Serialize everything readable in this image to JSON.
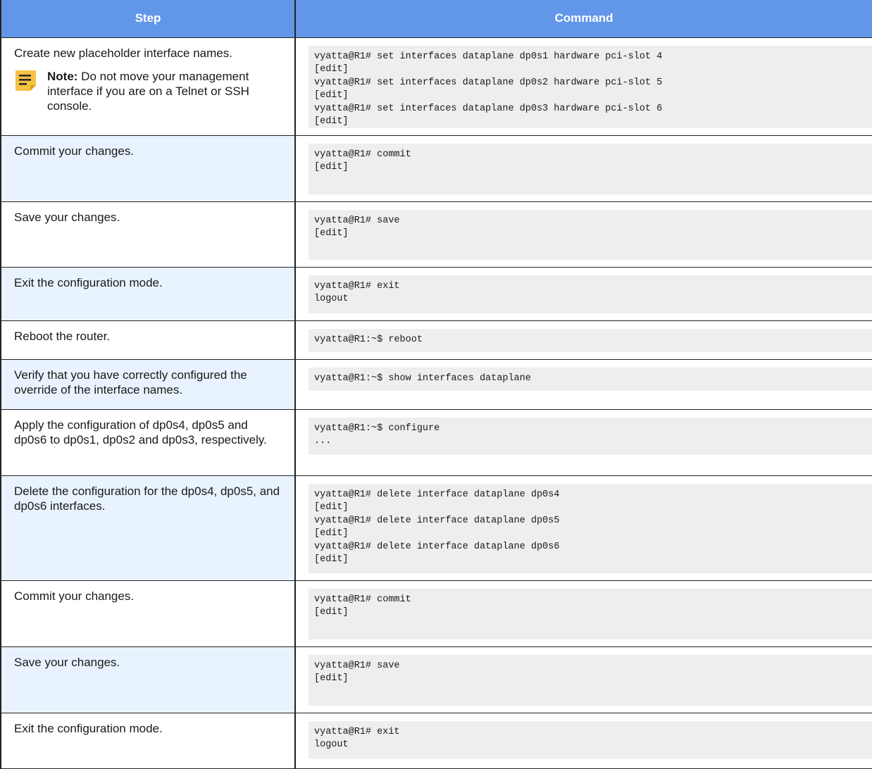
{
  "table": {
    "headers": {
      "step": "Step",
      "command": "Command"
    },
    "rows": [
      {
        "step": "Create new placeholder interface names.",
        "note_label": "Note:",
        "note_text": " Do not move your manage­ment interface if you are on a Telnet or SSH console.",
        "command_lines": [
          "vyatta@R1# set interfaces dataplane dp0s1 hardware pci-slot 4",
          "[edit]",
          "vyatta@R1# set interfaces dataplane dp0s2 hardware pci-slot 5",
          "[edit]",
          "vyatta@R1# set interfaces dataplane dp0s3 hardware pci-slot 6",
          "[edit]"
        ]
      },
      {
        "step": "Commit your changes.",
        "command_lines": [
          "vyatta@R1# commit",
          "[edit]"
        ]
      },
      {
        "step": "Save your changes.",
        "command_lines": [
          "vyatta@R1# save",
          "[edit]"
        ]
      },
      {
        "step": "Exit the configuration mode.",
        "command_lines": [
          "vyatta@R1# exit",
          "logout"
        ]
      },
      {
        "step": "Reboot the router.",
        "command_lines": [
          "vyatta@R1:~$ reboot"
        ]
      },
      {
        "step": "Verify that you have correctly configured the override of the interface names.",
        "command_lines": [
          "vyatta@R1:~$ show interfaces dataplane"
        ]
      },
      {
        "step": "Apply the configuration of dp0s4, dp0s5 and dp0s6 to dp0s1, dp0s2 and dp0s3, re­spectively.",
        "command_lines": [
          "vyatta@R1:~$ configure",
          "..."
        ]
      },
      {
        "step": "Delete the configuration for the dp0s4, dp0s5, and dp0s6 interfaces.",
        "command_lines": [
          "vyatta@R1# delete interface dataplane dp0s4",
          "[edit]",
          "vyatta@R1# delete interface dataplane dp0s5",
          "[edit]",
          "vyatta@R1# delete interface dataplane dp0s6",
          "[edit]"
        ]
      },
      {
        "step": "Commit your changes.",
        "command_lines": [
          "vyatta@R1# commit",
          "[edit]"
        ]
      },
      {
        "step": "Save your changes.",
        "command_lines": [
          "vyatta@R1# save",
          "[edit]"
        ]
      },
      {
        "step": "Exit the configuration mode.",
        "command_lines": [
          "vyatta@R1# exit",
          "logout"
        ]
      }
    ]
  },
  "colors": {
    "header_bg": "#6296e8",
    "header_text": "#ffffff",
    "alt_row_bg": "#e9f3ff",
    "code_bg": "#eeeeee",
    "note_icon": "#f5c242"
  },
  "icons": {
    "note": "note-icon"
  }
}
